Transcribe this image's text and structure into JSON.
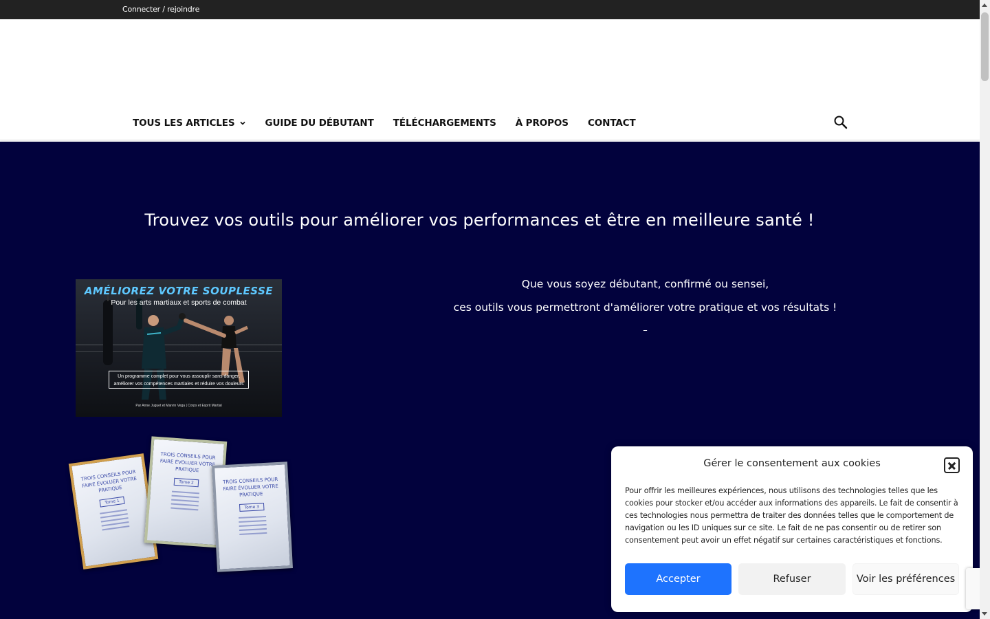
{
  "topbar": {
    "login_label": "Connecter / rejoindre"
  },
  "nav": {
    "items": [
      {
        "label": "TOUS LES ARTICLES",
        "has_dropdown": true
      },
      {
        "label": "GUIDE DU DÉBUTANT"
      },
      {
        "label": "TÉLÉCHARGEMENTS"
      },
      {
        "label": "À PROPOS"
      },
      {
        "label": "CONTACT"
      }
    ],
    "search_icon": "search-icon"
  },
  "hero": {
    "title": "Trouvez vos outils pour améliorer vos performances et être en meilleure santé !",
    "background_color": "#02023d",
    "intro_line1": "Que vous soyez débutant, confirmé ou sensei,",
    "intro_line2": "ces outils vous permettront d'améliorer votre pratique et vos résultats !",
    "intro_dash": "–"
  },
  "product1": {
    "title": "AMÉLIOREZ VOTRE SOUPLESSE",
    "subtitle": "Pour les arts martiaux et sports de combat",
    "box_line1": "Un programme complet pour vous assouplir sans danger,",
    "box_line2": "améliorer vos compétences martiales et réduire vos douleurs",
    "footer": "Par Anne Juguet et Marvin Vega | Corps et Esprit Martial"
  },
  "product2": {
    "books": [
      {
        "title": "TROIS CONSEILS POUR FAIRE ÉVOLUER VOTRE PRATIQUE",
        "tome": "Tome 1"
      },
      {
        "title": "TROIS CONSEILS POUR FAIRE ÉVOLUER VOTRE PRATIQUE",
        "tome": "Tome 2"
      },
      {
        "title": "TROIS CONSEILS POUR FAIRE ÉVOLUER VOTRE PRATIQUE",
        "tome": "Tome 3"
      }
    ]
  },
  "cookie": {
    "title": "Gérer le consentement aux cookies",
    "text": "Pour offrir les meilleures expériences, nous utilisons des technologies telles que les cookies pour stocker et/ou accéder aux informations des appareils. Le fait de consentir à ces technologies nous permettra de traiter des données telles que le comportement de navigation ou les ID uniques sur ce site. Le fait de ne pas consentir ou de retirer son consentement peut avoir un effet négatif sur certaines caractéristiques et fonctions.",
    "accept_label": "Accepter",
    "refuse_label": "Refuser",
    "prefs_label": "Voir les préférences",
    "accent_color": "#1e73fe"
  }
}
